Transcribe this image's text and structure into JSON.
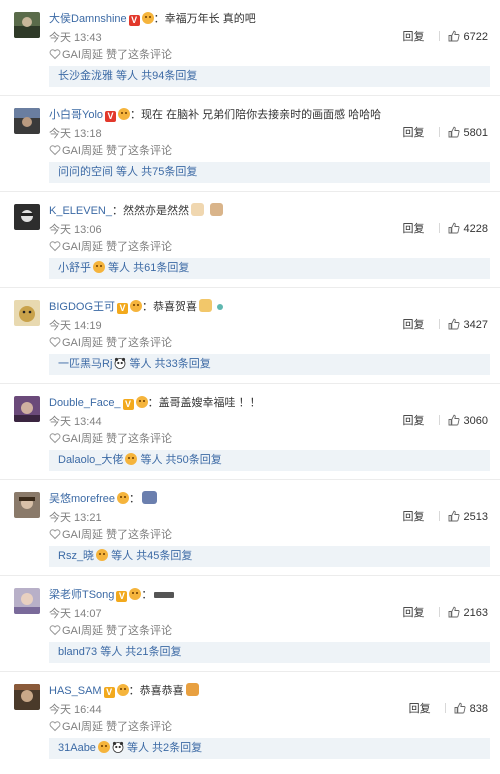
{
  "comments": [
    {
      "username": "大侯Damnshine",
      "badge": "red",
      "badge_text": "V",
      "text": "幸福万年长 真的吧",
      "time": "今天 13:43",
      "liked_by": "GAI周延 赞了这条评论",
      "reply_label": "回复",
      "likes": "6722",
      "replies_user": "长沙金泷雅",
      "replies_summary": " 等人 共94条回复",
      "avatar_color": "#5a6b4a"
    },
    {
      "username": "小白哥Yolo",
      "badge": "red",
      "badge_text": "V",
      "text": "现在 在脑补 兄弟们陪你去接亲时的画面感  哈哈哈",
      "time": "今天 13:18",
      "liked_by": "GAI周延 赞了这条评论",
      "reply_label": "回复",
      "likes": "5801",
      "replies_user": "问问的空间",
      "replies_summary": " 等人 共75条回复",
      "avatar_color": "#3a3a3a"
    },
    {
      "username": "K_ELEVEN_",
      "badge": "",
      "badge_text": "",
      "text": "然然亦是然然",
      "time": "今天 13:06",
      "liked_by": "GAI周延 赞了这条评论",
      "reply_label": "回复",
      "likes": "4228",
      "replies_user": "小舒乎",
      "replies_summary": " 等人 共61条回复",
      "avatar_color": "#2d2d2d"
    },
    {
      "username": "BIGDOG王可",
      "badge": "gold",
      "badge_text": "V",
      "text": "恭喜贺喜",
      "time": "今天 14:19",
      "liked_by": "GAI周延 赞了这条评论",
      "reply_label": "回复",
      "likes": "3427",
      "replies_user": "一匹黑马Rj",
      "replies_summary": " 等人 共33条回复",
      "avatar_color": "#c9a24a"
    },
    {
      "username": "Double_Face_",
      "badge": "gold",
      "badge_text": "V",
      "text": "盖哥盖嫂幸福哇 ！！",
      "time": "今天 13:44",
      "liked_by": "GAI周延 赞了这条评论",
      "reply_label": "回复",
      "likes": "3060",
      "replies_user": "Dalaolo_大佬",
      "replies_summary": " 等人 共50条回复",
      "avatar_color": "#6b4a7a"
    },
    {
      "username": "吴悠morefree",
      "badge": "",
      "badge_text": "",
      "text": "",
      "time": "今天 13:21",
      "liked_by": "GAI周延 赞了这条评论",
      "reply_label": "回复",
      "likes": "2513",
      "replies_user": "Rsz_晓",
      "replies_summary": " 等人 共45条回复",
      "avatar_color": "#8a7a6a"
    },
    {
      "username": "梁老师TSong",
      "badge": "gold",
      "badge_text": "V",
      "text": "",
      "time": "今天 14:07",
      "liked_by": "GAI周延 赞了这条评论",
      "reply_label": "回复",
      "likes": "2163",
      "replies_user": "bland73",
      "replies_summary": " 等人 共21条回复",
      "avatar_color": "#b8b0c8"
    },
    {
      "username": "HAS_SAM",
      "badge": "gold",
      "badge_text": "V",
      "text": "恭喜恭喜",
      "time": "今天 16:44",
      "liked_by": "GAI周延 赞了这条评论",
      "reply_label": "回复",
      "likes": "838",
      "replies_user": "31Aabe",
      "replies_summary": " 等人 共2条回复",
      "avatar_color": "#4a3a2a"
    }
  ]
}
